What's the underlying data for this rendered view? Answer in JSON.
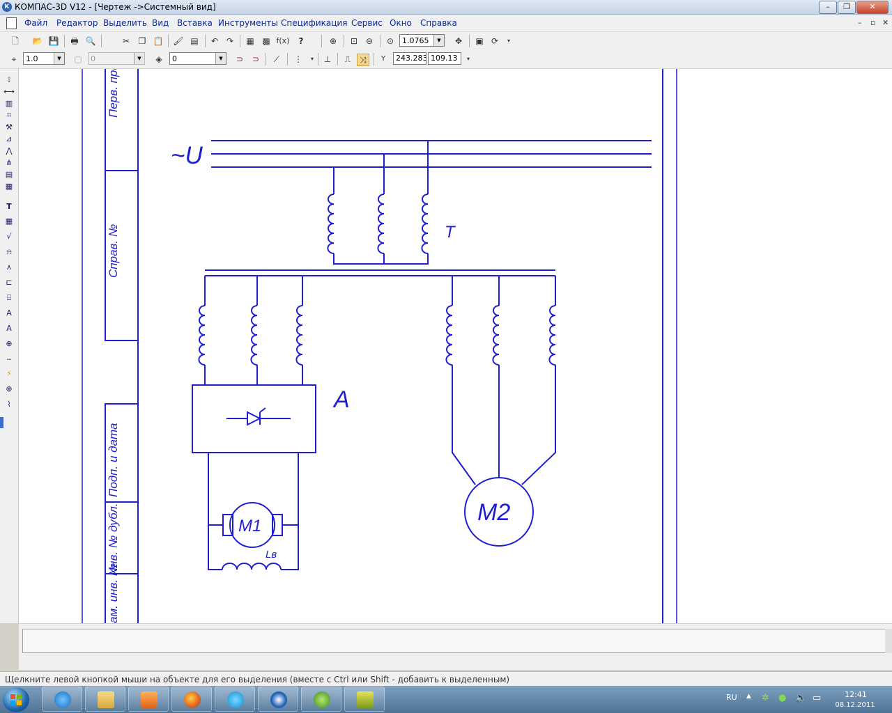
{
  "window": {
    "title": "КОМПАС-3D V12 - [Чертеж ->Системный вид]",
    "app_icon": "K",
    "controls": {
      "minimize": "–",
      "restore": "❐",
      "close": "✕"
    }
  },
  "menu": {
    "items": [
      "Файл",
      "Редактор",
      "Выделить",
      "Вид",
      "Вставка",
      "Инструменты",
      "Спецификация",
      "Сервис",
      "Окно",
      "Справка"
    ],
    "mdi_controls": {
      "minimize": "–",
      "restore": "▫",
      "close": "✕"
    }
  },
  "toolbar_standard": {
    "zoom_value": "1.0765",
    "formula_label": "f(x)",
    "help_label": "?"
  },
  "toolbar_view": {
    "step_value": "1.0",
    "style_value": "0",
    "layer_value": "0",
    "coord_x": "243.283",
    "coord_y": "109.13",
    "coord_label": "Y"
  },
  "drawing": {
    "stamp_labels": [
      "Перв. примен.",
      "Справ. №",
      "Подп. и дата",
      "Инв. № дубл.",
      "Взам. инв. №"
    ],
    "supply_label": "~U",
    "transformer_label": "T",
    "converter_label": "A",
    "motor1_label": "M1",
    "winding_label": "Lв",
    "motor2_label": "M2"
  },
  "status": {
    "text": "Щелкните левой кнопкой мыши на объекте для его выделения (вместе с Ctrl или Shift - добавить к выделенным)"
  },
  "taskbar": {
    "apps": [
      "internet-explorer",
      "file-explorer",
      "media-player",
      "firefox",
      "skype",
      "kompas",
      "torrent",
      "tool"
    ],
    "language": "RU",
    "time": "12:41",
    "date": "08.12.2011"
  },
  "colors": {
    "drawing_line": "#1f1fd1",
    "frame_line": "#1f1fd1",
    "menu_text": "#0a2a9c",
    "taskbar": "#5b7fa2"
  }
}
